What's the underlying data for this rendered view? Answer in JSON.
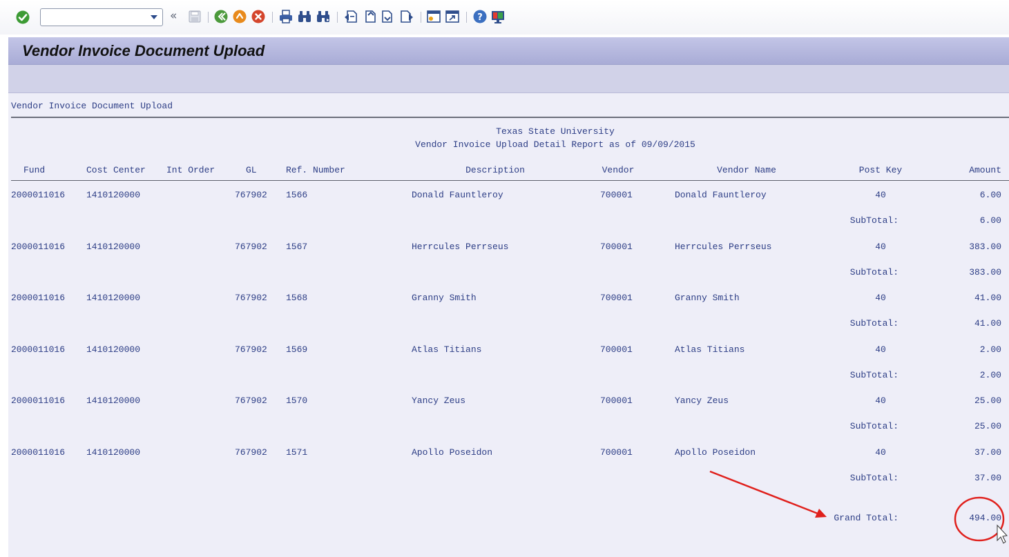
{
  "toolbar": {
    "command_field_value": "",
    "icons": [
      "check-icon",
      "dropdown-arrow-icon",
      "double-left-icon",
      "save-icon",
      "back-icon",
      "exit-icon",
      "cancel-icon",
      "print-icon",
      "find-icon",
      "find-next-icon",
      "first-page-icon",
      "previous-page-icon",
      "next-page-icon",
      "last-page-icon",
      "create-session-icon",
      "shortcut-icon",
      "help-icon",
      "customize-layout-icon"
    ]
  },
  "window": {
    "title": "Vendor Invoice Document Upload"
  },
  "report": {
    "program_title": "Vendor Invoice Document Upload",
    "header_line1": "Texas State University",
    "header_line2": "Vendor Invoice Upload Detail Report as of 09/09/2015",
    "columns": [
      "Fund",
      "Cost Center",
      "Int Order",
      "GL",
      "Ref. Number",
      "Description",
      "Vendor",
      "Vendor Name",
      "Post Key",
      "Amount"
    ],
    "rows": [
      {
        "fund": "2000011016",
        "cost_center": "1410120000",
        "int_order": "",
        "gl": "767902",
        "ref": "1566",
        "description": "Donald Fauntleroy",
        "vendor": "700001",
        "vendor_name": "Donald Fauntleroy",
        "post_key": "40",
        "amount": "6.00",
        "subtotal_label": "SubTotal:",
        "subtotal": "6.00"
      },
      {
        "fund": "2000011016",
        "cost_center": "1410120000",
        "int_order": "",
        "gl": "767902",
        "ref": "1567",
        "description": "Herrcules Perrseus",
        "vendor": "700001",
        "vendor_name": "Herrcules Perrseus",
        "post_key": "40",
        "amount": "383.00",
        "subtotal_label": "SubTotal:",
        "subtotal": "383.00"
      },
      {
        "fund": "2000011016",
        "cost_center": "1410120000",
        "int_order": "",
        "gl": "767902",
        "ref": "1568",
        "description": "Granny Smith",
        "vendor": "700001",
        "vendor_name": "Granny Smith",
        "post_key": "40",
        "amount": "41.00",
        "subtotal_label": "SubTotal:",
        "subtotal": "41.00"
      },
      {
        "fund": "2000011016",
        "cost_center": "1410120000",
        "int_order": "",
        "gl": "767902",
        "ref": "1569",
        "description": "Atlas Titians",
        "vendor": "700001",
        "vendor_name": "Atlas Titians",
        "post_key": "40",
        "amount": "2.00",
        "subtotal_label": "SubTotal:",
        "subtotal": "2.00"
      },
      {
        "fund": "2000011016",
        "cost_center": "1410120000",
        "int_order": "",
        "gl": "767902",
        "ref": "1570",
        "description": "Yancy Zeus",
        "vendor": "700001",
        "vendor_name": "Yancy Zeus",
        "post_key": "40",
        "amount": "25.00",
        "subtotal_label": "SubTotal:",
        "subtotal": "25.00"
      },
      {
        "fund": "2000011016",
        "cost_center": "1410120000",
        "int_order": "",
        "gl": "767902",
        "ref": "1571",
        "description": "Apollo Poseidon",
        "vendor": "700001",
        "vendor_name": "Apollo Poseidon",
        "post_key": "40",
        "amount": "37.00",
        "subtotal_label": "SubTotal:",
        "subtotal": "37.00"
      }
    ],
    "grand_total_label": "Grand Total:",
    "grand_total": "494.00"
  },
  "colors": {
    "report_text": "#2c3d85",
    "title_bar": "#b3b6dd",
    "report_background": "#eeeef8",
    "annotation": "#e0201c"
  }
}
